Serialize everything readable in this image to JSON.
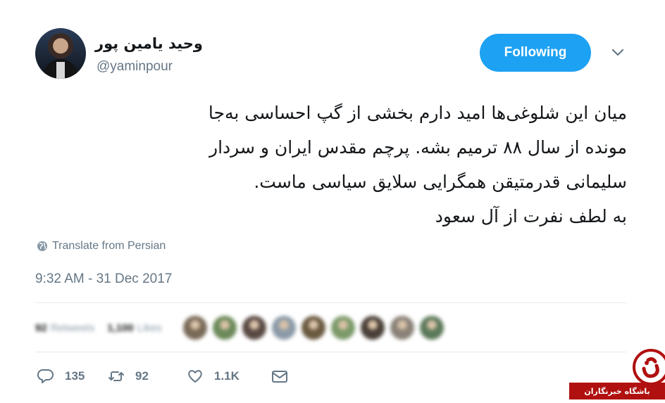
{
  "user": {
    "display_name": "وحید یامین پور",
    "handle": "@yaminpour"
  },
  "follow_button": {
    "label": "Following"
  },
  "tweet": {
    "lines": [
      "میان این شلوغی‌ها امید دارم بخشی از گپ احساسی به‌جا",
      "مونده از سال ۸۸ ترمیم بشه. پرچم مقدس ایران و سردار",
      "سلیمانی قدرمتیقن همگرایی سلایق سیاسی ماست.",
      "به لطف نفرت از آل سعود"
    ]
  },
  "translate": {
    "label": "Translate from Persian",
    "icon": "globe-icon"
  },
  "timestamp": "9:32 AM - 31 Dec 2017",
  "stats": {
    "retweets_count": "92",
    "retweets_label": "Retweets",
    "likes_count": "1,100",
    "likes_label": "Likes",
    "liker_colors": [
      "#7a6a58",
      "#6c8a5a",
      "#5a4a44",
      "#8c9aa8",
      "#6a5a40",
      "#7c9a6a",
      "#4a4038",
      "#8a8278",
      "#5c7a5a"
    ]
  },
  "actions": {
    "reply_count": "135",
    "retweet_count": "92",
    "like_count": "1.1K"
  },
  "watermark": {
    "text": "باشگاه خبرنگاران",
    "color": "#b0100f"
  },
  "colors": {
    "accent": "#1da1f2",
    "secondary_text": "#657786"
  }
}
